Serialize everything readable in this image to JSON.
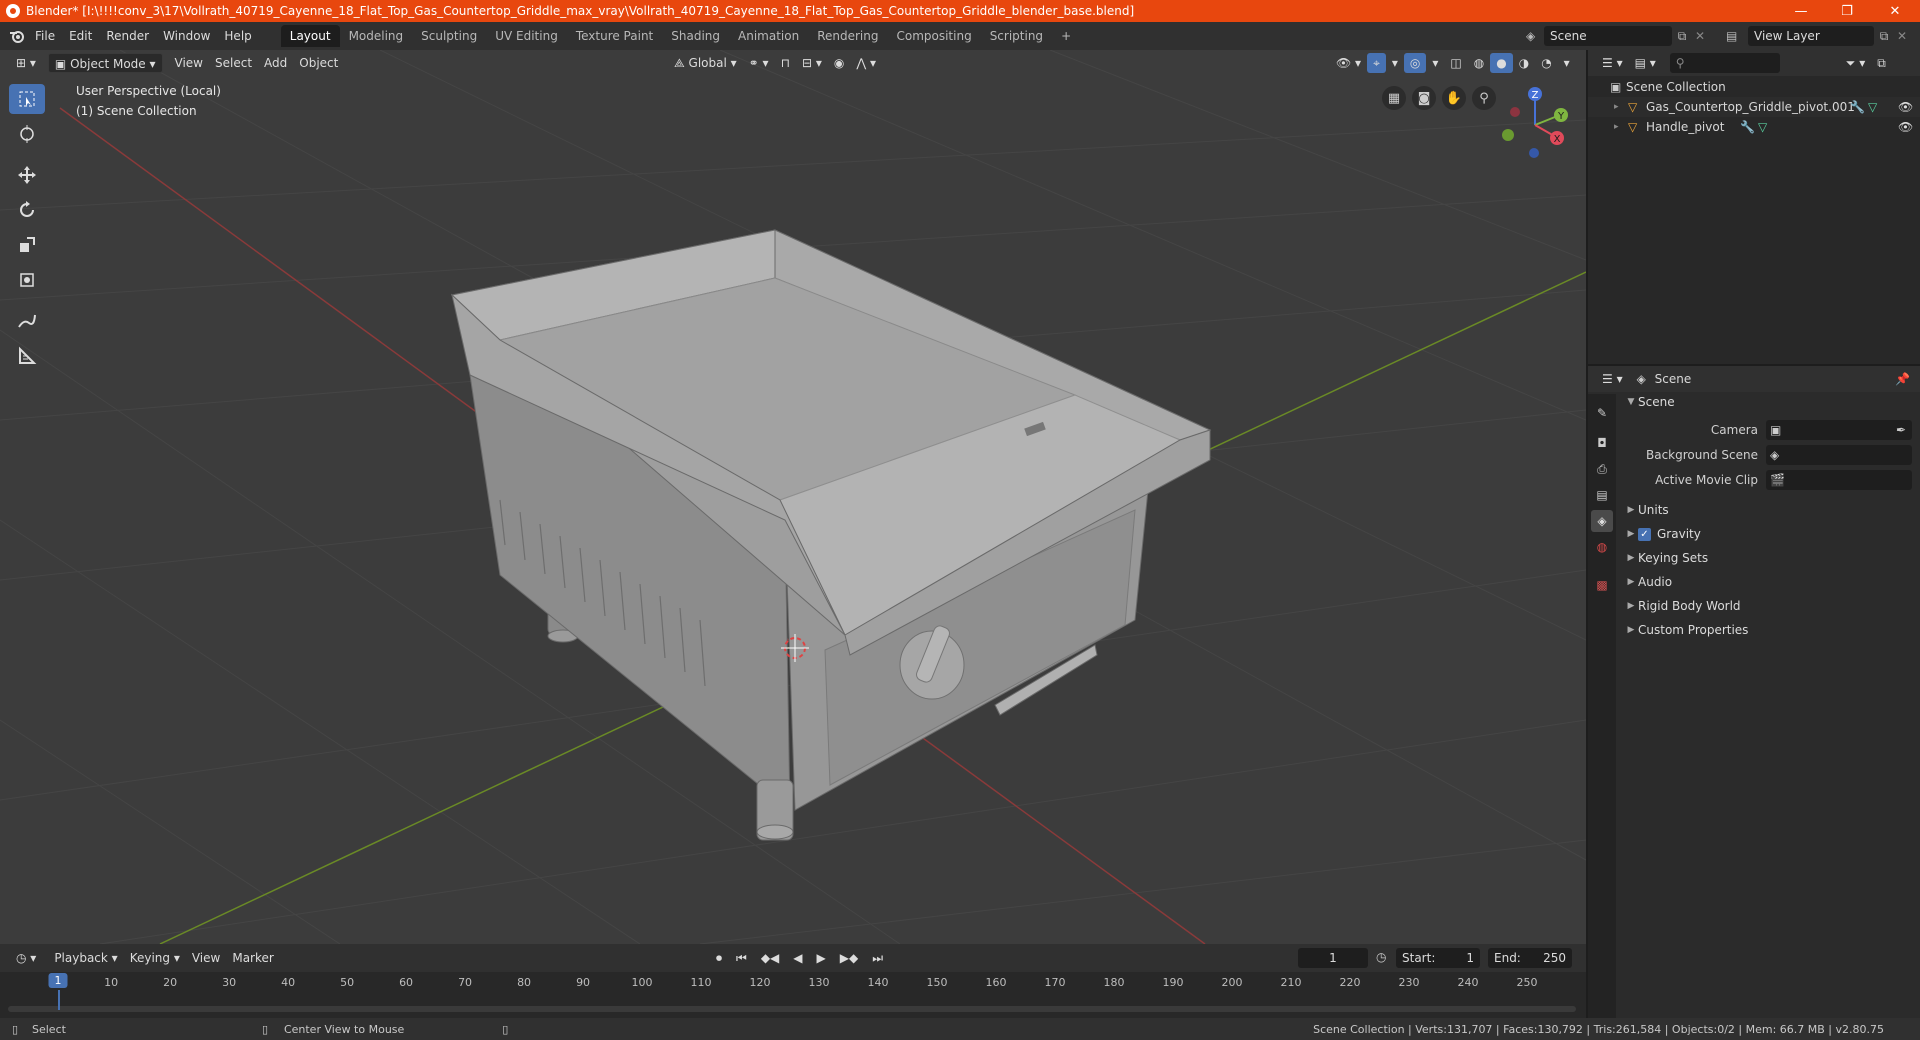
{
  "window": {
    "title": "Blender* [I:\\!!!!conv_3\\17\\Vollrath_40719_Cayenne_18_Flat_Top_Gas_Countertop_Griddle_max_vray\\Vollrath_40719_Cayenne_18_Flat_Top_Gas_Countertop_Griddle_blender_base.blend]",
    "minimize": "—",
    "maximize": "❐",
    "close": "✕",
    "titlebar_color": "#e8470e"
  },
  "menu": {
    "items": [
      "File",
      "Edit",
      "Render",
      "Window",
      "Help"
    ],
    "workspaces": [
      "Layout",
      "Modeling",
      "Sculpting",
      "UV Editing",
      "Texture Paint",
      "Shading",
      "Animation",
      "Rendering",
      "Compositing",
      "Scripting"
    ],
    "active_workspace": "Layout",
    "add_workspace": "+",
    "scene_label": "Scene",
    "view_layer_label": "View Layer"
  },
  "viewport": {
    "mode": "Object Mode",
    "menus": [
      "View",
      "Select",
      "Add",
      "Object"
    ],
    "orientation": "Global",
    "overlay_line1": "User Perspective (Local)",
    "overlay_line2": "(1) Scene Collection",
    "background_color": "#3c3c3c",
    "gizmo": {
      "z": "Z",
      "y": "Y",
      "x": "X"
    },
    "tools": [
      "select-box",
      "cursor",
      "move",
      "rotate",
      "scale",
      "transform",
      "annotate",
      "measure"
    ]
  },
  "outliner": {
    "root": "Scene Collection",
    "items": [
      {
        "label": "Gas_Countertop_Griddle_pivot.001"
      },
      {
        "label": "Handle_pivot"
      }
    ]
  },
  "properties": {
    "header_title": "Scene",
    "section_title": "Scene",
    "fields": [
      {
        "label": "Camera",
        "value": ""
      },
      {
        "label": "Background Scene",
        "value": ""
      },
      {
        "label": "Active Movie Clip",
        "value": ""
      }
    ],
    "subsections": [
      {
        "label": "Units",
        "checkbox": false
      },
      {
        "label": "Gravity",
        "checkbox": true
      },
      {
        "label": "Keying Sets",
        "checkbox": false
      },
      {
        "label": "Audio",
        "checkbox": false
      },
      {
        "label": "Rigid Body World",
        "checkbox": false
      },
      {
        "label": "Custom Properties",
        "checkbox": false
      }
    ]
  },
  "timeline": {
    "menus": [
      "Playback",
      "Keying",
      "View",
      "Marker"
    ],
    "current_frame": "1",
    "start_label": "Start:",
    "start_value": "1",
    "end_label": "End:",
    "end_value": "250",
    "ticks": [
      "1",
      "10",
      "20",
      "30",
      "40",
      "50",
      "60",
      "70",
      "80",
      "90",
      "100",
      "110",
      "120",
      "130",
      "140",
      "150",
      "160",
      "170",
      "180",
      "190",
      "200",
      "210",
      "220",
      "230",
      "240",
      "250"
    ],
    "accent_color": "#4772b3"
  },
  "statusbar": {
    "left_action": "Select",
    "middle_action": "Center View to Mouse",
    "stats": "Scene Collection | Verts:131,707 | Faces:130,792 | Tris:261,584 | Objects:0/2 | Mem: 66.7 MB | v2.80.75"
  }
}
